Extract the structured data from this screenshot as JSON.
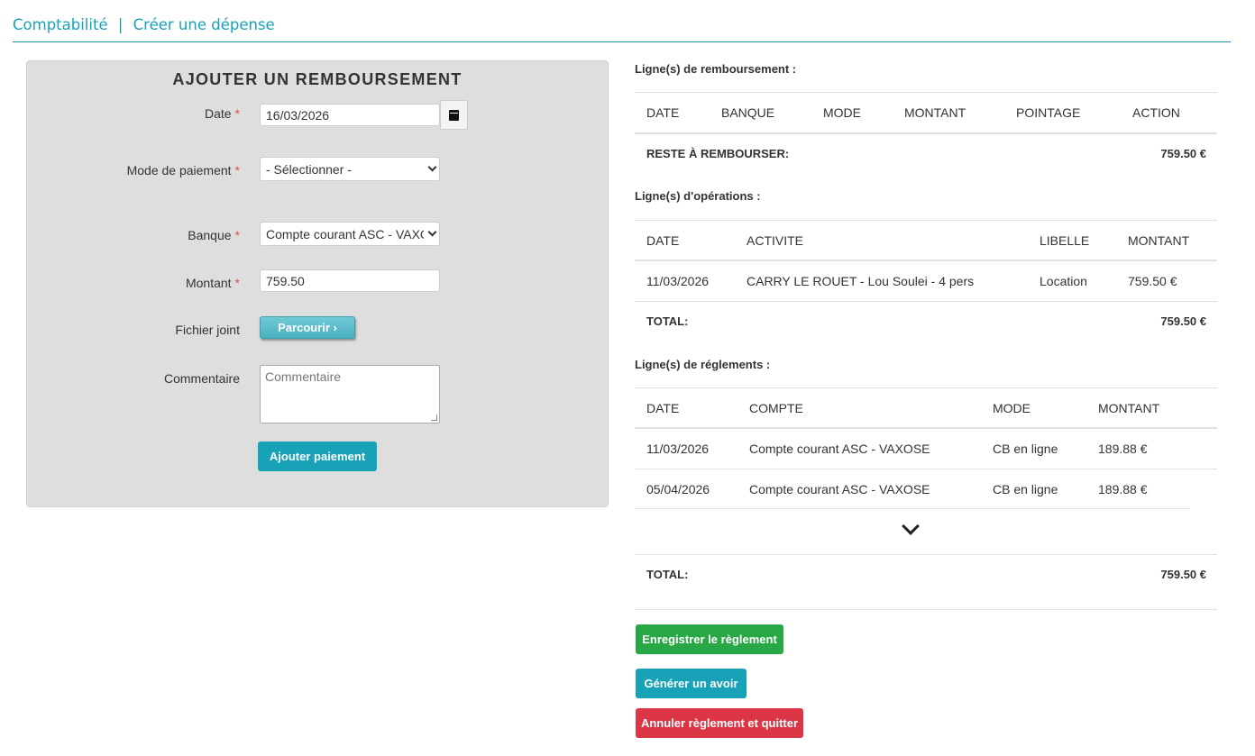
{
  "breadcrumb": {
    "section": "Comptabilité",
    "separator": "|",
    "page": "Créer une dépense"
  },
  "form": {
    "title": "AJOUTER UN REMBOURSEMENT",
    "required_mark": "*",
    "date": {
      "label": "Date",
      "value": "16/03/2026",
      "icon": "calendar-icon"
    },
    "payment_mode": {
      "label": "Mode de paiement",
      "selected": "- Sélectionner -"
    },
    "bank": {
      "label": "Banque",
      "selected": "Compte courant ASC - VAXO"
    },
    "amount": {
      "label": "Montant",
      "value": "759.50"
    },
    "attachment": {
      "label": "Fichier joint",
      "button": "Parcourir ›"
    },
    "comment": {
      "label": "Commentaire",
      "placeholder": "Commentaire"
    },
    "submit_label": "Ajouter paiement"
  },
  "refunds": {
    "title": "Ligne(s) de remboursement :",
    "headers": [
      "DATE",
      "BANQUE",
      "MODE",
      "MONTANT",
      "POINTAGE",
      "ACTION"
    ],
    "remaining_label": "RESTE À REMBOURSER:",
    "remaining_value": "759.50 €"
  },
  "operations": {
    "title": "Ligne(s) d'opérations :",
    "headers": [
      "DATE",
      "ACTIVITE",
      "LIBELLE",
      "MONTANT"
    ],
    "rows": [
      [
        "11/03/2026",
        "CARRY LE ROUET - Lou Soulei - 4 pers",
        "Location",
        "759.50 €"
      ]
    ],
    "total_label": "TOTAL:",
    "total_value": "759.50 €"
  },
  "payments": {
    "title": "Ligne(s) de réglements :",
    "headers": [
      "DATE",
      "COMPTE",
      "MODE",
      "MONTANT"
    ],
    "rows": [
      [
        "11/03/2026",
        "Compte courant ASC - VAXOSE",
        "CB en ligne",
        "189.88 €"
      ],
      [
        "05/04/2026",
        "Compte courant ASC - VAXOSE",
        "CB en ligne",
        "189.88 €"
      ]
    ],
    "expand_icon": "chevron-down-icon",
    "total_label": "TOTAL:",
    "total_value": "759.50 €"
  },
  "actions": {
    "save": "Enregistrer le règlement",
    "credit": "Générer un avoir",
    "cancel": "Annuler règlement et quitter"
  },
  "colors": {
    "accent": "#17a2b8",
    "success": "#28a745",
    "danger": "#dc3545",
    "panel": "#dedede",
    "required": "#d9534f"
  }
}
